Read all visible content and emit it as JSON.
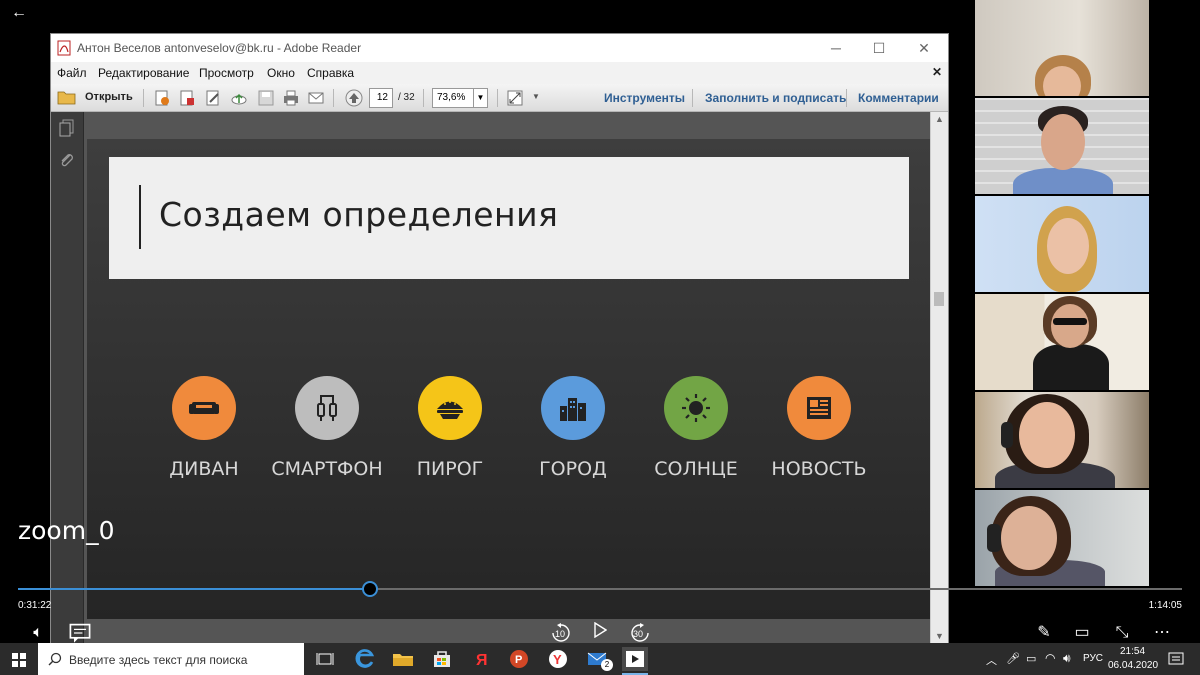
{
  "player": {
    "back_glyph": "←",
    "video_name": "zoom_0",
    "elapsed": "0:31:22",
    "remaining": "1:14:05",
    "progress_fraction": 0.302,
    "replay_label": "10",
    "forward_label": "30"
  },
  "reader": {
    "window_title": "Антон Веселов antonveselov@bk.ru - Adobe Reader",
    "menu": [
      "Файл",
      "Редактирование",
      "Просмотр",
      "Окно",
      "Справка"
    ],
    "open_label": "Открыть",
    "page_current": "12",
    "page_total": "/ 32",
    "zoom": "73,6%",
    "tools_label": "Инструменты",
    "fill_sign_label": "Заполнить и подписать",
    "comments_label": "Комментарии"
  },
  "slide": {
    "heading": "Создаем определения",
    "items": [
      {
        "label": "ДИВАН",
        "color": "#f08a3c",
        "icon": "sofa-icon"
      },
      {
        "label": "СМАРТФОН",
        "color": "#bdbdbd",
        "icon": "cable-icon"
      },
      {
        "label": "ПИРОГ",
        "color": "#f5c518",
        "icon": "pie-icon"
      },
      {
        "label": "ГОРОД",
        "color": "#5b9bdc",
        "icon": "city-icon"
      },
      {
        "label": "СОЛНЦЕ",
        "color": "#72a545",
        "icon": "sun-icon"
      },
      {
        "label": "НОВОСТЬ",
        "color": "#f08a3c",
        "icon": "newspaper-icon"
      }
    ]
  },
  "taskbar": {
    "search_placeholder": "Введите здесь текст для поиска",
    "lang": "РУС",
    "time": "21:54",
    "date": "06.04.2020",
    "mail_badge": "2"
  }
}
